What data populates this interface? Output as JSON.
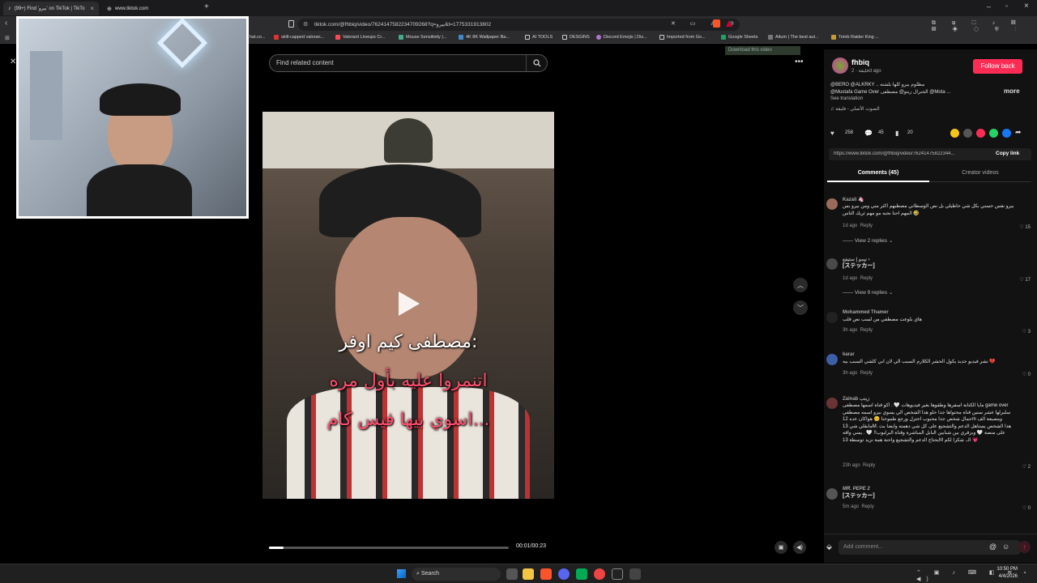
{
  "browser": {
    "tabs": [
      {
        "title": "(99+) Find 'بيرو' on TikTok | TikTo",
        "active": true
      },
      {
        "title": "www.tiktok.com",
        "active": false
      }
    ],
    "url": "tiktok.com/@fhbiq/video/7624147582234709268?q=بيرو&t=1775331913802",
    "bookmarks": [
      "skill-capped valoran...",
      "Valorant Lineups Cr...",
      "Mouse Sensitivity |...",
      "4K 8K Wallpaper Ba...",
      "AI TOOLS",
      "DESGINS",
      "Discord Emojis | Dis...",
      "Imported from Go...",
      "Google Sheets",
      "Aitum | The best aut...",
      "Tomb Raider King ..."
    ],
    "bookmark_partial": "hat.co..."
  },
  "search": {
    "placeholder": "Find related content"
  },
  "download_banner": "Download this video",
  "video": {
    "captions": [
      "مصطفى كيم اوفر:",
      "اتنمروا عليه بأول مره",
      "اسوي بيها فيس كام..."
    ],
    "time": "00:01/00:23",
    "progress": 0.06
  },
  "author": {
    "name": "fhbiq",
    "sub": "فليقة · 2d ago",
    "follow_label": "Follow back",
    "description_1": "@BERO @ALKRKY .. مظلوم بيرو كلها بلشته",
    "description_2": "@Mustafa Game Over الجنرال زيتو@ مصطفى @Mota ...",
    "more": "more",
    "see_translation": "See translation",
    "sound": "الصوت الأصلي - فليقة"
  },
  "stats": {
    "likes": "258",
    "comments": "45",
    "saves": "20"
  },
  "link": {
    "url": "https://www.tiktok.com/@fhbiq/video/76241475822344...",
    "copy_label": "Copy link"
  },
  "tabs": {
    "comments": "Comments (45)",
    "creator_videos": "Creator videos"
  },
  "comments": [
    {
      "name": "Kazali 🦄",
      "text": "بيرو نفس حسني بكل شي حاطيلي بل نص الوسطاني مصطبهم اكثر مني ومن بيرو بس المهم احنا نحبه مو مهم ثريك التاس 🤣",
      "time": "1d ago",
      "reply": "Reply",
      "likes": "15",
      "replies": "View 2 replies",
      "color": "#9a6b5b"
    },
    {
      "name": "نيمو | ستيفع ›",
      "text": "[ステッカー]",
      "time": "1d ago",
      "reply": "Reply",
      "likes": "17",
      "replies": "View 9 replies",
      "color": "#4a4a4a"
    },
    {
      "name": "Mohammed Thamer",
      "text": "هاي بلوعت مصطفي من لسب نص قلب",
      "time": "3h ago",
      "reply": "Reply",
      "likes": "3",
      "replies": "",
      "color": "#222"
    },
    {
      "name": "karar",
      "text": "نشر فيديو جديد يكول الحشر الكلارم السبب الي لان اني كلشي السبب بيه 💔",
      "time": "3h ago",
      "reply": "Reply",
      "likes": "0",
      "replies": "",
      "color": "#3d5fa8"
    },
    {
      "name": "Zainab زينب",
      "text": "مايا الكتابة اسفرها وطقوها بغير فيديوهات 🤍 . اكو قناة اسمها مصطفى game over سلبرلها عشر سنين قناة محتواها جدا حلو هذا الشخص الي يسوي بيرو اسمه مصطفي جمال شخص جدا محبوب احتزل ورجع طموحنا 😊 هواكان عده 12m ومصيعة الف مابقلي شي 13M. هذا الشخص يستاهل الدعم والتشجيع على كل شي دهمته وايضا بث على منصة 🤍 وبزقري بين شبابين البابل المباشرة وقناة البرلبوب!! 🤍 . يمني واقه يحتاج الدعم والتشجيع واحنة همة نزيد توسطة 13M الـ. شكرا لكم 💗",
      "time": "23h ago",
      "reply": "Reply",
      "likes": "2",
      "replies": "",
      "color": "#6b3434"
    },
    {
      "name": "MR. PEPE 2",
      "text": "[ステッカー]",
      "time": "5m ago",
      "reply": "Reply",
      "likes": "0",
      "replies": "",
      "color": "#555"
    }
  ],
  "add_comment": {
    "placeholder": "Add comment..."
  },
  "taskbar": {
    "search_label": "Search",
    "time": "10:50 PM",
    "date": "4/4/2026"
  },
  "colors": {
    "accent": "#fe2c55",
    "background": "#000000",
    "panel": "#121212"
  }
}
